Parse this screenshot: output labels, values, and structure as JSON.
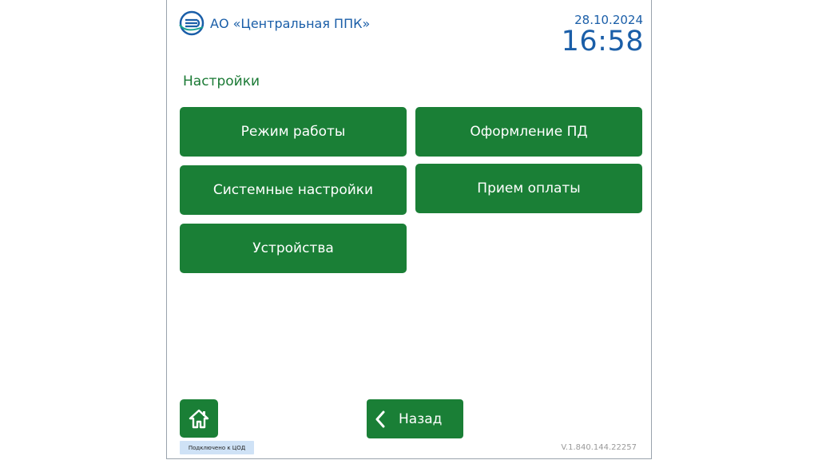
{
  "header": {
    "company": "АО «Центральная ППК»",
    "date": "28.10.2024",
    "time": "16:58"
  },
  "page": {
    "title": "Настройки"
  },
  "menu": {
    "work_mode": "Режим работы",
    "system_settings": "Системные настройки",
    "devices": "Устройства",
    "pd_issue": "Оформление ПД",
    "payment": "Прием оплаты"
  },
  "footer": {
    "home_icon": "home-icon",
    "status": "Подключено к ЦОД",
    "back_label": "Назад",
    "version": "V.1.840.144.22257"
  },
  "colors": {
    "accent_green": "#1a7f36",
    "brand_blue": "#1a5ea8",
    "status_bg": "#cfe2f6"
  }
}
